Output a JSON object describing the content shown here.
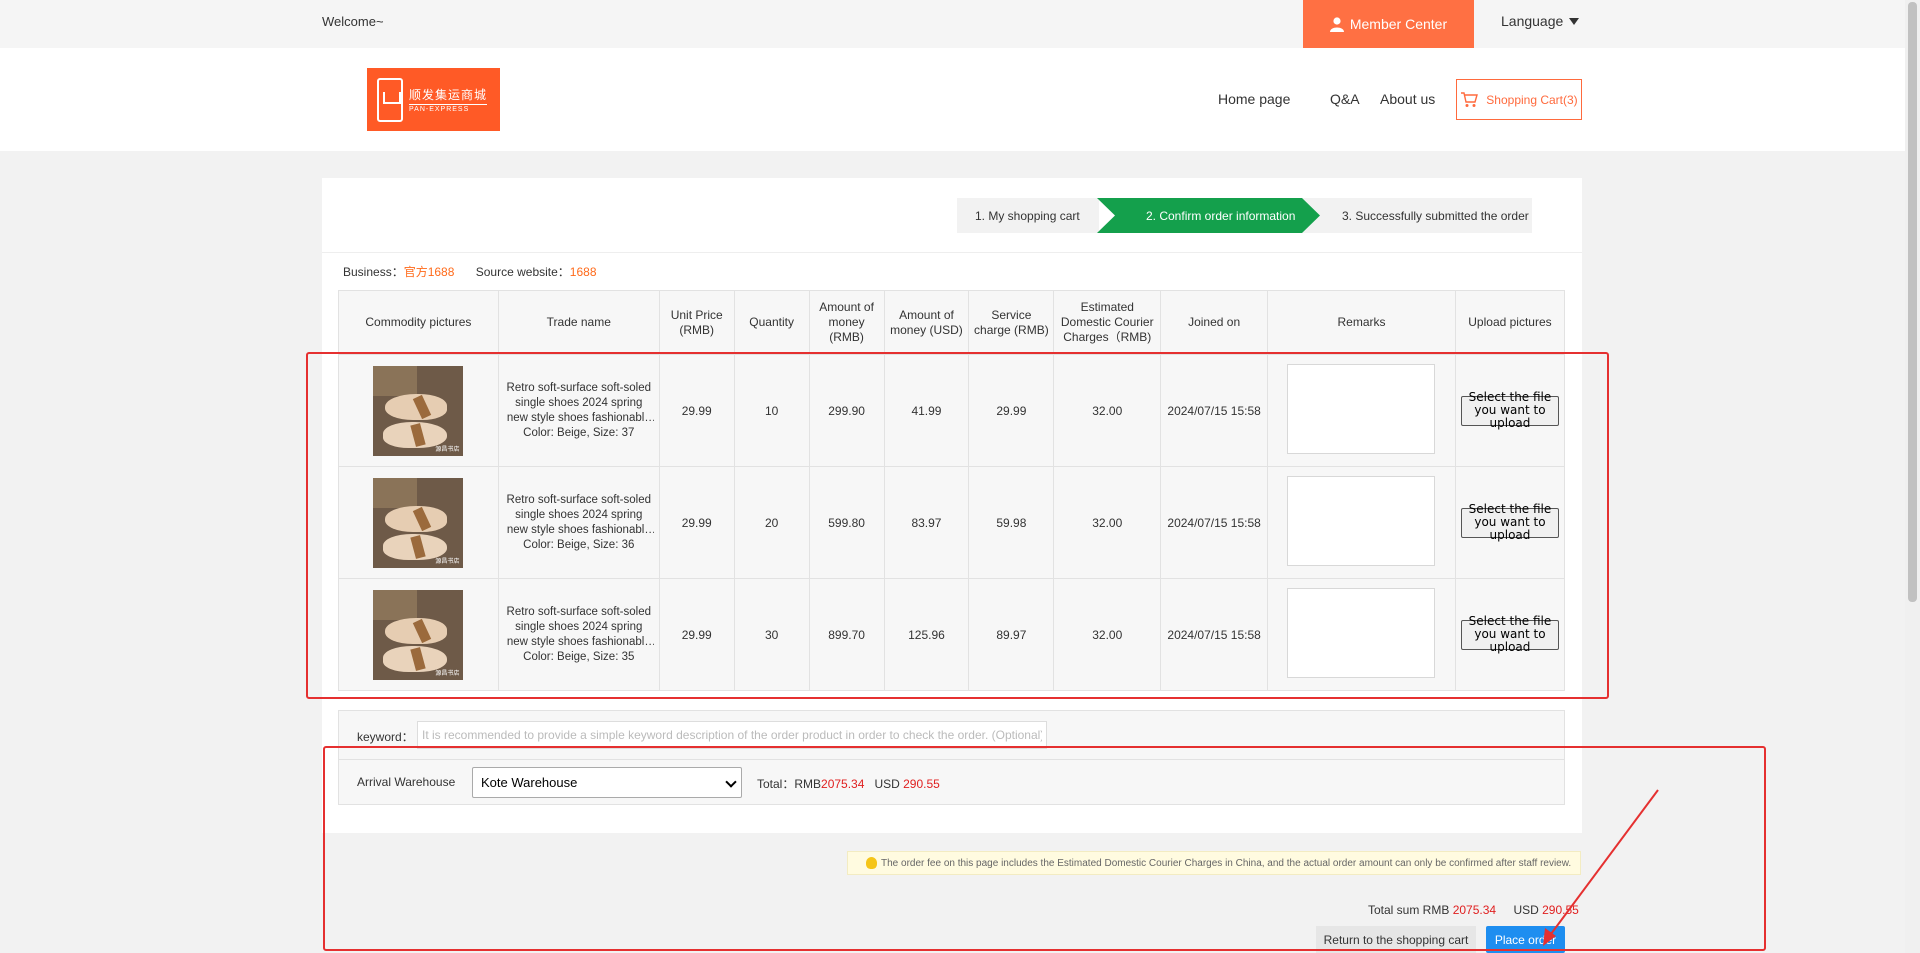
{
  "topbar": {
    "welcome": "Welcome~",
    "member_center": "Member Center",
    "language": "Language"
  },
  "header": {
    "logo_cn": "顺发集运商城",
    "logo_en": "PAN-EXPRESS",
    "nav": [
      "Home page",
      "Q&A",
      "About us"
    ],
    "cart": "Shopping Cart(3)"
  },
  "steps": [
    "1. My shopping cart",
    "2. Confirm order information",
    "3. Successfully submitted the order"
  ],
  "business": {
    "business_label": "Business：",
    "business_value": "官方1688",
    "source_label": "Source website：",
    "source_value": "1688"
  },
  "table": {
    "headers": [
      "Commodity pictures",
      "Trade name",
      "Unit Price (RMB)",
      "Quantity",
      "Amount of money (RMB)",
      "Amount of money (USD)",
      "Service charge (RMB)",
      "Estimated Domestic Courier Charges（RMB)",
      "Joined on",
      "Remarks",
      "Upload pictures"
    ],
    "rows": [
      {
        "name": "Retro soft-surface soft-soled single shoes 2024 spring new style shoes fashionable and versatile",
        "spec": "Color: Beige, Size: 37",
        "unit_price": "29.99",
        "quantity": "10",
        "amount_rmb": "299.90",
        "amount_usd": "41.99",
        "service": "29.99",
        "courier": "32.00",
        "joined": "2024/07/15 15:58",
        "upload": "Select the file you want to upload"
      },
      {
        "name": "Retro soft-surface soft-soled single shoes 2024 spring new style shoes fashionable and versatile",
        "spec": "Color: Beige, Size: 36",
        "unit_price": "29.99",
        "quantity": "20",
        "amount_rmb": "599.80",
        "amount_usd": "83.97",
        "service": "59.98",
        "courier": "32.00",
        "joined": "2024/07/15 15:58",
        "upload": "Select the file you want to upload"
      },
      {
        "name": "Retro soft-surface soft-soled single shoes 2024 spring new style shoes fashionable and versatile",
        "spec": "Color: Beige, Size: 35",
        "unit_price": "29.99",
        "quantity": "30",
        "amount_rmb": "899.70",
        "amount_usd": "125.96",
        "service": "89.97",
        "courier": "32.00",
        "joined": "2024/07/15 15:58",
        "upload": "Select the file you want to upload"
      }
    ],
    "thumb_watermark": "源昌书店"
  },
  "keyword": {
    "label": "keyword：",
    "placeholder": "It is recommended to provide a simple keyword description of the order product in order to check the order. (Optional)"
  },
  "warehouse": {
    "label": "Arrival Warehouse",
    "selected": "Kote Warehouse",
    "total_label": "Total：",
    "rmb_prefix": "RMB",
    "rmb_value": "2075.34",
    "usd_prefix": "USD",
    "usd_value": "290.55"
  },
  "notice": "The order fee on this page includes the Estimated Domestic Courier Charges in China, and the actual order amount can only be confirmed after staff review.",
  "summary": {
    "label": "Total sum RMB",
    "rmb_value": "2075.34",
    "usd_prefix": "USD",
    "usd_value": "290.55"
  },
  "buttons": {
    "return": "Return to the shopping cart",
    "place": "Place order"
  },
  "colors": {
    "accent": "#ff7043",
    "step_active": "#14a04c",
    "primary_button": "#1e8ef0",
    "annotation": "#e53030"
  }
}
